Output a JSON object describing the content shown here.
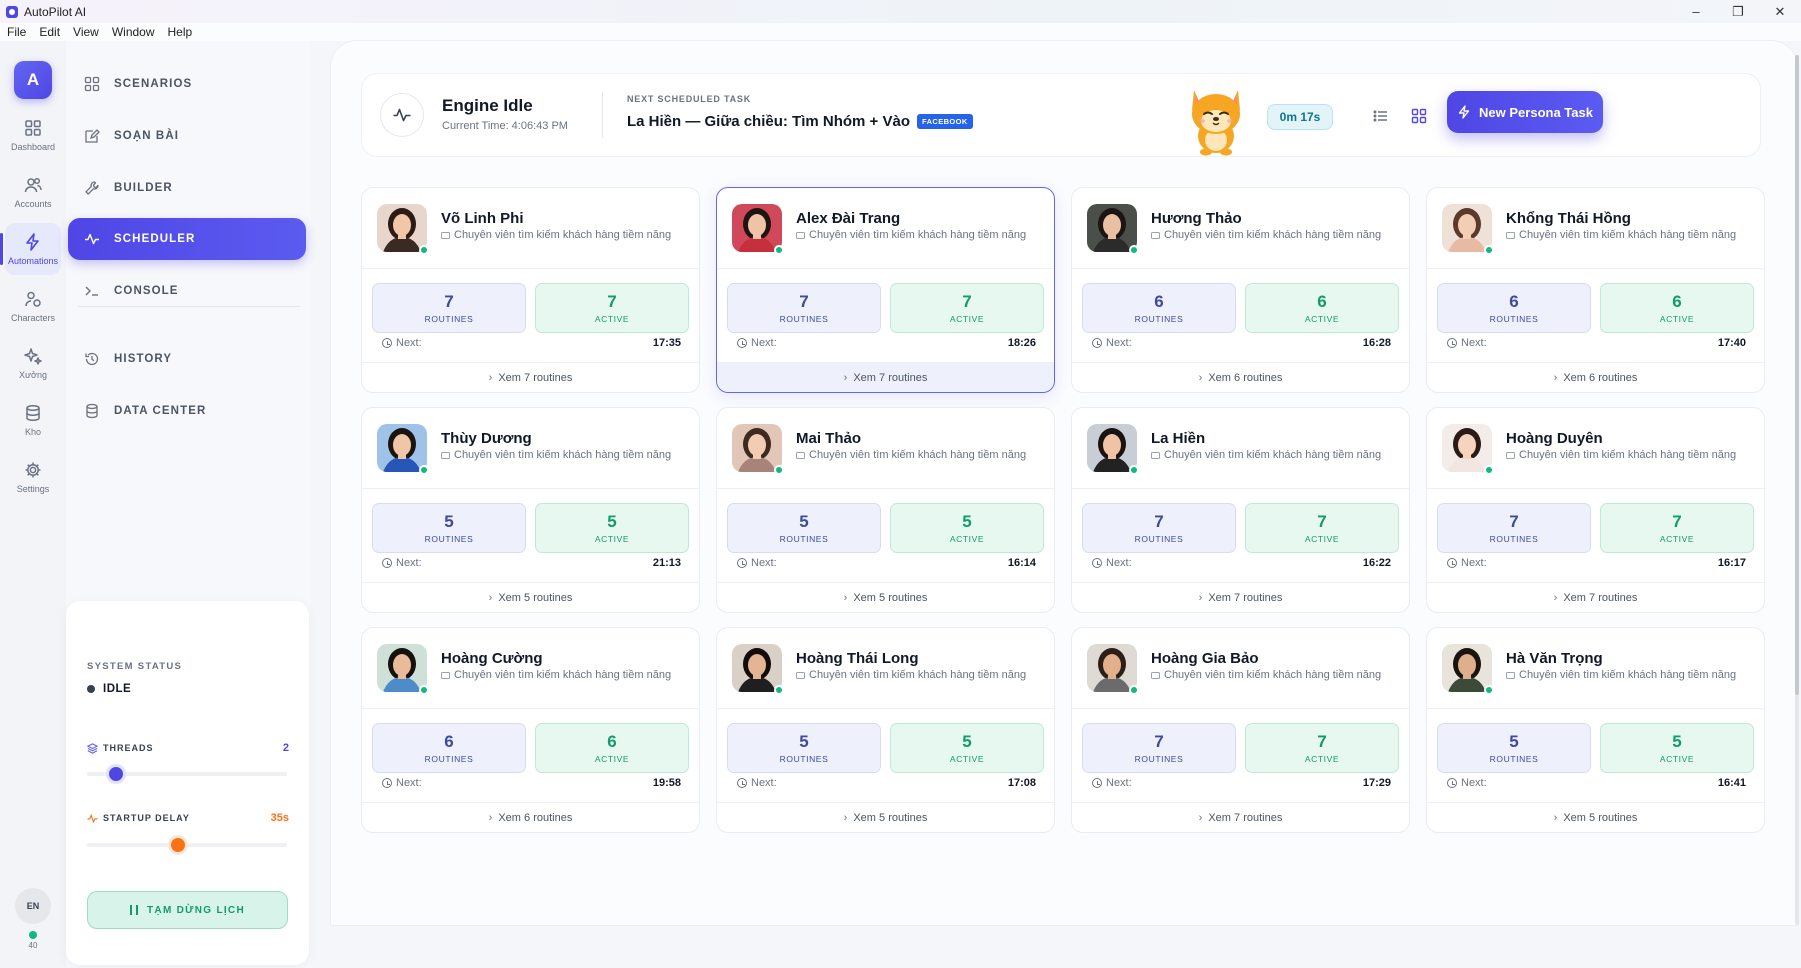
{
  "window": {
    "title": "AutoPilot AI",
    "controls": [
      "–",
      "❐",
      "✕"
    ]
  },
  "menu": [
    "File",
    "Edit",
    "View",
    "Window",
    "Help"
  ],
  "rail": {
    "avatar_letter": "A",
    "items": [
      {
        "label": "Dashboard",
        "icon": "grid-icon"
      },
      {
        "label": "Accounts",
        "icon": "users-icon"
      },
      {
        "label": "Automations",
        "icon": "bolt-icon",
        "active": true
      },
      {
        "label": "Characters",
        "icon": "characters-icon"
      },
      {
        "label": "Xưởng",
        "icon": "sparkles-icon"
      },
      {
        "label": "Kho",
        "icon": "database-icon"
      },
      {
        "label": "Settings",
        "icon": "gear-icon"
      }
    ],
    "lang": "EN",
    "online_count": "40"
  },
  "sidebar": {
    "nav": [
      {
        "label": "SCENARIOS",
        "icon": "grid-icon"
      },
      {
        "label": "SOẠN BÀI",
        "icon": "compose-icon"
      },
      {
        "label": "BUILDER",
        "icon": "wrench-icon"
      },
      {
        "label": "SCHEDULER",
        "icon": "pulse-icon",
        "active": true
      },
      {
        "label": "CONSOLE",
        "icon": "terminal-icon"
      },
      {
        "label": "HISTORY",
        "icon": "history-icon"
      },
      {
        "label": "DATA CENTER",
        "icon": "database-icon"
      }
    ],
    "system_status": {
      "label": "SYSTEM STATUS",
      "state": "IDLE",
      "threads_label": "THREADS",
      "threads_value": "2",
      "threads_fraction": 0.12,
      "startup_delay_label": "STARTUP DELAY",
      "startup_delay_value": "35s",
      "startup_delay_fraction": 0.45,
      "pause_button": "TẠM DỪNG LỊCH"
    }
  },
  "header": {
    "engine_title": "Engine Idle",
    "current_time": "Current Time: 4:06:43 PM",
    "next_label": "NEXT SCHEDULED TASK",
    "next_task": "La Hiền — Giữa chiều: Tìm Nhóm + Vào",
    "next_platform": "FACEBOOK",
    "timer": "0m 17s",
    "new_button": "New Persona Task"
  },
  "colors": {
    "accent": "#4f46e5",
    "active_green": "#149a6e",
    "online": "#10b981",
    "facebook": "#2563eb",
    "startup_knob": "#f97316"
  },
  "cards": [
    {
      "name": "Võ Linh Phi",
      "role": "Chuyên viên tìm kiếm khách hàng tiềm năng",
      "routines": "7",
      "active": "7",
      "routines_label": "ROUTINES",
      "active_label": "ACTIVE",
      "next_label": "Next:",
      "next_time": "17:35",
      "footer": "Xem 7 routines"
    },
    {
      "name": "Alex Đài Trang",
      "role": "Chuyên viên tìm kiếm khách hàng tiềm năng",
      "routines": "7",
      "active": "7",
      "routines_label": "ROUTINES",
      "active_label": "ACTIVE",
      "next_label": "Next:",
      "next_time": "18:26",
      "footer": "Xem 7 routines",
      "selected": true
    },
    {
      "name": "Hương Thảo",
      "role": "Chuyên viên tìm kiếm khách hàng tiềm năng",
      "routines": "6",
      "active": "6",
      "routines_label": "ROUTINES",
      "active_label": "ACTIVE",
      "next_label": "Next:",
      "next_time": "16:28",
      "footer": "Xem 6 routines"
    },
    {
      "name": "Khổng Thái Hồng",
      "role": "Chuyên viên tìm kiếm khách hàng tiềm năng",
      "routines": "6",
      "active": "6",
      "routines_label": "ROUTINES",
      "active_label": "ACTIVE",
      "next_label": "Next:",
      "next_time": "17:40",
      "footer": "Xem 6 routines"
    },
    {
      "name": "Thùy Dương",
      "role": "Chuyên viên tìm kiếm khách hàng tiềm năng",
      "routines": "5",
      "active": "5",
      "routines_label": "ROUTINES",
      "active_label": "ACTIVE",
      "next_label": "Next:",
      "next_time": "21:13",
      "footer": "Xem 5 routines"
    },
    {
      "name": "Mai Thảo",
      "role": "Chuyên viên tìm kiếm khách hàng tiềm năng",
      "routines": "5",
      "active": "5",
      "routines_label": "ROUTINES",
      "active_label": "ACTIVE",
      "next_label": "Next:",
      "next_time": "16:14",
      "footer": "Xem 5 routines"
    },
    {
      "name": "La Hiền",
      "role": "Chuyên viên tìm kiếm khách hàng tiềm năng",
      "routines": "7",
      "active": "7",
      "routines_label": "ROUTINES",
      "active_label": "ACTIVE",
      "next_label": "Next:",
      "next_time": "16:22",
      "footer": "Xem 7 routines"
    },
    {
      "name": "Hoàng Duyên",
      "role": "Chuyên viên tìm kiếm khách hàng tiềm năng",
      "routines": "7",
      "active": "7",
      "routines_label": "ROUTINES",
      "active_label": "ACTIVE",
      "next_label": "Next:",
      "next_time": "16:17",
      "footer": "Xem 7 routines"
    },
    {
      "name": "Hoàng Cường",
      "role": "Chuyên viên tìm kiếm khách hàng tiềm năng",
      "routines": "6",
      "active": "6",
      "routines_label": "ROUTINES",
      "active_label": "ACTIVE",
      "next_label": "Next:",
      "next_time": "19:58",
      "footer": "Xem 6 routines"
    },
    {
      "name": "Hoàng Thái Long",
      "role": "Chuyên viên tìm kiếm khách hàng tiềm năng",
      "routines": "5",
      "active": "5",
      "routines_label": "ROUTINES",
      "active_label": "ACTIVE",
      "next_label": "Next:",
      "next_time": "17:08",
      "footer": "Xem 5 routines"
    },
    {
      "name": "Hoàng Gia Bảo",
      "role": "Chuyên viên tìm kiếm khách hàng tiềm năng",
      "routines": "7",
      "active": "7",
      "routines_label": "ROUTINES",
      "active_label": "ACTIVE",
      "next_label": "Next:",
      "next_time": "17:29",
      "footer": "Xem 7 routines"
    },
    {
      "name": "Hà Văn Trọng",
      "role": "Chuyên viên tìm kiếm khách hàng tiềm năng",
      "routines": "5",
      "active": "5",
      "routines_label": "ROUTINES",
      "active_label": "ACTIVE",
      "next_label": "Next:",
      "next_time": "16:41",
      "footer": "Xem 5 routines"
    }
  ]
}
